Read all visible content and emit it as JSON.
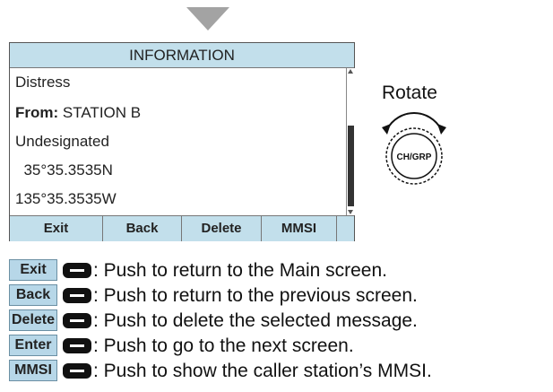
{
  "screen": {
    "title": "INFORMATION",
    "lines": {
      "type": "Distress",
      "from_label": "From:",
      "from_value": " STATION B",
      "nature": "Undesignated",
      "latitude": "  35°35.3535N",
      "longitude": "135°35.3535W"
    },
    "softkeys": [
      "Exit",
      "Back",
      "Delete",
      "MMSI"
    ]
  },
  "dial": {
    "label": "Rotate",
    "knob_text": "CH/GRP"
  },
  "legend": [
    {
      "key": "Exit",
      "text": ": Push to return to the Main screen."
    },
    {
      "key": "Back",
      "text": ": Push to return to the previous screen."
    },
    {
      "key": "Delete",
      "text": ": Push to delete the selected message."
    },
    {
      "key": "Enter",
      "text": ": Push to go to the next screen."
    },
    {
      "key": "MMSI",
      "text": ": Push to show the caller station’s MMSI."
    }
  ]
}
